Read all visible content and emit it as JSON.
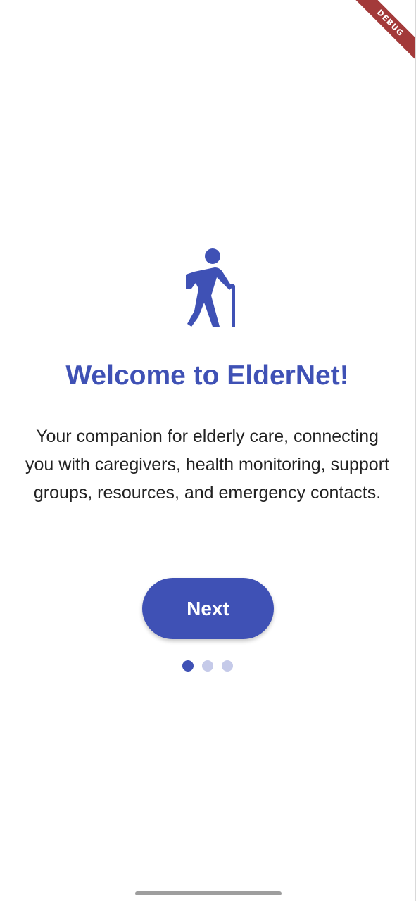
{
  "debug_banner": {
    "label": "DEBUG"
  },
  "onboarding": {
    "icon": "elderly-person-with-cane-icon",
    "title": "Welcome to ElderNet!",
    "description": "Your companion for elderly care, connecting you with caregivers, health monitoring, support groups, resources, and emergency contacts.",
    "next_label": "Next",
    "pages_total": 3,
    "current_page": 1
  },
  "colors": {
    "primary": "#3f51b5",
    "dot_inactive": "#c5cae9",
    "text": "#222222",
    "background": "#ffffff"
  }
}
